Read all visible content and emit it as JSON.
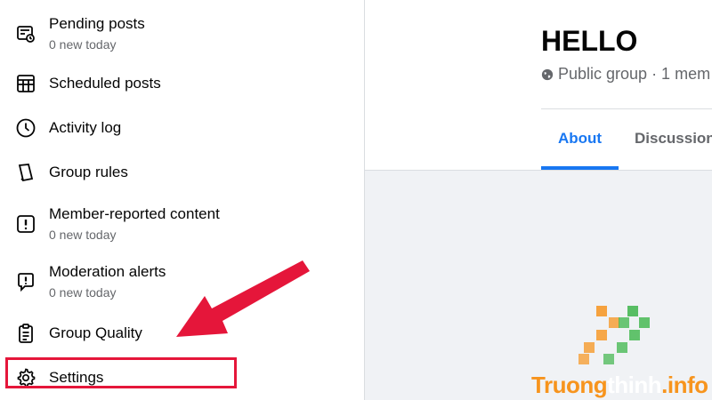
{
  "sidebar": {
    "items": [
      {
        "title": "Pending posts",
        "sub": "0 new today",
        "icon": "pending-posts-icon"
      },
      {
        "title": "Scheduled posts",
        "sub": "",
        "icon": "scheduled-posts-icon"
      },
      {
        "title": "Activity log",
        "sub": "",
        "icon": "clock-icon"
      },
      {
        "title": "Group rules",
        "sub": "",
        "icon": "book-icon"
      },
      {
        "title": "Member-reported content",
        "sub": "0 new today",
        "icon": "report-icon"
      },
      {
        "title": "Moderation alerts",
        "sub": "0 new today",
        "icon": "alert-bubble-icon"
      },
      {
        "title": "Group Quality",
        "sub": "",
        "icon": "clipboard-icon"
      },
      {
        "title": "Settings",
        "sub": "",
        "icon": "gear-icon"
      }
    ]
  },
  "group": {
    "title": "HELLO",
    "meta": "Public group · 1 mem",
    "tabs": {
      "about": "About",
      "discussion": "Discussion"
    }
  },
  "watermark": {
    "part1": "Truong",
    "part2": "thinh",
    "part3": ".info"
  },
  "colors": {
    "accent": "#1877f2",
    "highlight": "#e5163a",
    "logo_orange": "#f7941d",
    "logo_green": "#3db54a"
  }
}
